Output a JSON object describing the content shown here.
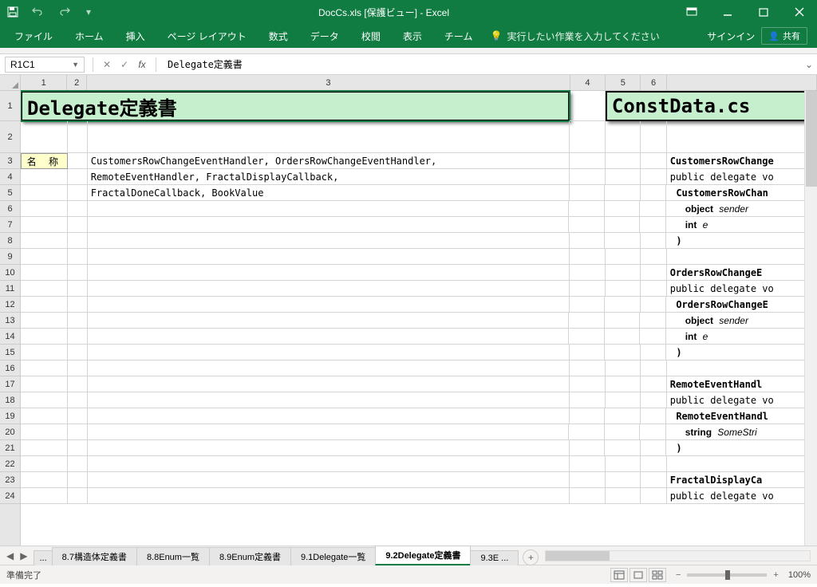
{
  "titlebar": {
    "title": "DocCs.xls [保護ビュー] - Excel"
  },
  "ribbon": {
    "tabs": [
      "ファイル",
      "ホーム",
      "挿入",
      "ページ レイアウト",
      "数式",
      "データ",
      "校閲",
      "表示",
      "チーム"
    ],
    "tellme": "実行したい作業を入力してください",
    "signin": "サインイン",
    "share": "共有"
  },
  "formula": {
    "namebox": "R1C1",
    "fx": "fx",
    "content": "Delegate定義書"
  },
  "cols": [
    "1",
    "2",
    "3",
    "4",
    "5",
    "6"
  ],
  "rows": [
    "1",
    "2",
    "3",
    "4",
    "5",
    "6",
    "7",
    "8",
    "9",
    "10",
    "11",
    "12",
    "13",
    "14",
    "15",
    "16",
    "17",
    "18",
    "19",
    "20",
    "21",
    "22",
    "23",
    "24"
  ],
  "cells": {
    "title_left": "Delegate定義書",
    "title_right": "ConstData.cs",
    "label_r3c1": "名 称",
    "r3c3": "CustomersRowChangeEventHandler, OrdersRowChangeEventHandler,",
    "r4c3": "RemoteEventHandler, FractalDisplayCallback,",
    "r5c3": "FractalDoneCallback, BookValue",
    "right": {
      "l1": "CustomersRowChange",
      "l2": "public delegate vo",
      "l3": "CustomersRowChan",
      "l4_a": "object",
      "l4_b": "sender",
      "l5_a": "int",
      "l5_b": "e",
      "l6": ")",
      "l8": "OrdersRowChangeE",
      "l9": "public delegate vo",
      "l10": "OrdersRowChangeE",
      "l11_a": "object",
      "l11_b": "sender",
      "l12_a": "int",
      "l12_b": "e",
      "l13": ")",
      "l15": "RemoteEventHandl",
      "l16": "public delegate vo",
      "l17": "RemoteEventHandl",
      "l18_a": "string",
      "l18_b": "SomeStri",
      "l19": ")",
      "l21": "FractalDisplayCa",
      "l22": "public delegate vo"
    }
  },
  "sheets": {
    "ellipsis": "...",
    "tabs": [
      "8.7構造体定義書",
      "8.8Enum一覧",
      "8.9Enum定義書",
      "9.1Delegate一覧",
      "9.2Delegate定義書"
    ],
    "partial": "9.3E",
    "active_index": 4
  },
  "status": {
    "ready": "準備完了",
    "zoom": "100%"
  }
}
